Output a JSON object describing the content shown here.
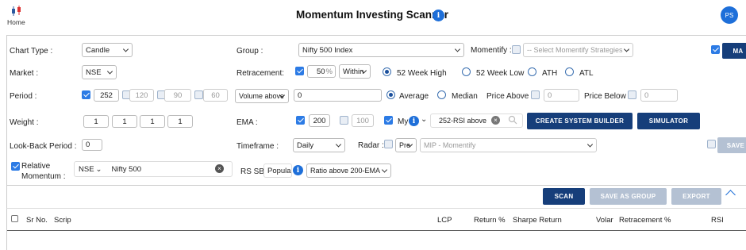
{
  "nav": {
    "home_label": "Home",
    "title": "Momentum Investing Scanner",
    "avatar": "PS"
  },
  "form": {
    "chart_type": {
      "label": "Chart Type :",
      "value": "Candle"
    },
    "market": {
      "label": "Market :",
      "value": "NSE"
    },
    "period": {
      "label": "Period :",
      "values": [
        "252",
        "120",
        "90",
        "60"
      ]
    },
    "weight": {
      "label": "Weight :",
      "values": [
        "1",
        "1",
        "1",
        "1"
      ]
    },
    "lookback": {
      "label": "Look-Back Period :",
      "value": "0"
    },
    "relative_momentum": {
      "label": "Relative\nMomentum :",
      "exchange": "NSE",
      "index": "Nifty 500"
    },
    "group": {
      "label": "Group :",
      "value": "Nifty 500 Index"
    },
    "momentify": {
      "label": "Momentify :",
      "placeholder": "-- Select Momentify Strategies --"
    },
    "ma_label": "MA",
    "retracement": {
      "label": "Retracement:",
      "value": "50",
      "unit": "%",
      "mode": "Within",
      "options": [
        "52 Week High",
        "52 Week Low",
        "ATH",
        "ATL"
      ]
    },
    "volume": {
      "mode": "Volume above",
      "value": "0",
      "options": [
        "Average",
        "Median"
      ],
      "price_above_label": "Price Above :",
      "price_above": "0",
      "price_below_label": "Price Below :",
      "price_below": "0"
    },
    "ema": {
      "label": "EMA :",
      "value1": "200",
      "value2": "100",
      "my_label": "My",
      "my_value": "252-RSI above"
    },
    "create_system_builder": "CREATE SYSTEM BUILDER",
    "simulator": "SIMULATOR",
    "timeframe": {
      "label": "Timeframe :",
      "value": "Daily"
    },
    "radar": {
      "label": "Radar :",
      "mode": "Pre",
      "value": "MIP - Momentify"
    },
    "save_label": "SAVE",
    "rs_sb": {
      "label": "RS SB :",
      "mode": "Popular",
      "value": "Ratio above 200-EMA"
    }
  },
  "actions": {
    "scan": "SCAN",
    "save_as_group": "SAVE AS GROUP",
    "export": "EXPORT"
  },
  "table": {
    "columns": [
      "Sr No.",
      "Scrip",
      "LCP",
      "Return %",
      "Sharpe Return",
      "Volar",
      "Retracement %",
      "RSI"
    ]
  }
}
